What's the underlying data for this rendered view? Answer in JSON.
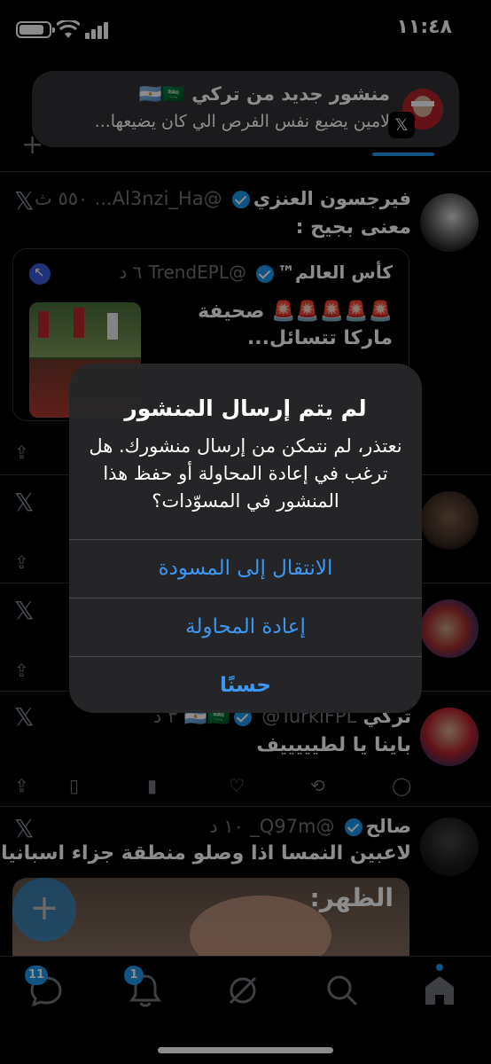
{
  "status": {
    "time": "١١:٤٨",
    "battery_level": 0.85
  },
  "notification": {
    "title": "منشور جديد من تركي 🇦🇷🇸🇦",
    "body": "لامين يضيع نفس الفرص الي كان يضيعها...",
    "app_icon": "x-logo-icon"
  },
  "posts": [
    {
      "author": "فيرجسون العنزي",
      "handle": "@Al3nzi_Ha...",
      "time": "٥٥٠ ث",
      "text": "معنى بجيح :",
      "quote": {
        "author": "كأس العالم™",
        "handle": "@TrendEPL",
        "time": "٦ د",
        "line1": "🚨🚨🚨🚨🚨 صحيفة",
        "line2": "ماركا تتسائل..."
      }
    },
    {
      "author": "تركي 🇦🇷🇸🇦",
      "handle": "@TurkiFPL",
      "time": "٣ د",
      "text": "باينا يا لطيييييف"
    },
    {
      "author": "صالح",
      "handle": "@Q97m_",
      "time": "١٠ د",
      "text": "لاعبين النمسا اذا وصلو منطقة جزاء اسبانيا",
      "video_caption": "الظهر:"
    }
  ],
  "alert": {
    "title": "لم يتم إرسال المنشور",
    "message": "نعتذر، لم نتمكن من إرسال منشورك. هل ترغب في إعادة المحاولة أو حفظ هذا المنشور في المسوّدات؟",
    "buttons": [
      "الانتقال إلى المسودة",
      "إعادة المحاولة",
      "حسنًا"
    ]
  },
  "fab": {
    "label": "+"
  },
  "tabbar": {
    "messages_badge": "11",
    "notifications_badge": "1"
  },
  "colors": {
    "accent": "#1d9bf0",
    "alert_button": "#3b97f3",
    "background": "#000000"
  }
}
